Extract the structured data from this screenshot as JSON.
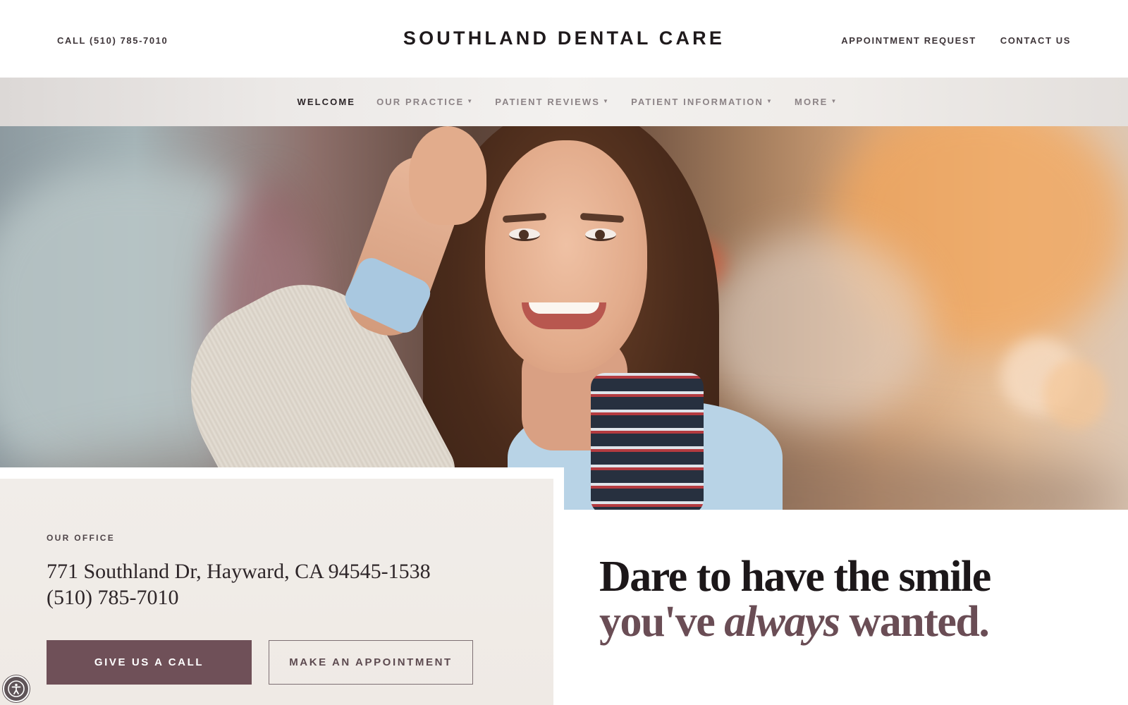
{
  "header": {
    "call_label": "CALL (510) 785-7010",
    "brand": "SOUTHLAND DENTAL CARE",
    "links": [
      "APPOINTMENT REQUEST",
      "CONTACT US"
    ]
  },
  "nav": {
    "items": [
      {
        "label": "WELCOME",
        "has_dropdown": false,
        "active": true
      },
      {
        "label": "OUR PRACTICE",
        "has_dropdown": true,
        "active": false
      },
      {
        "label": "PATIENT REVIEWS",
        "has_dropdown": true,
        "active": false
      },
      {
        "label": "PATIENT INFORMATION",
        "has_dropdown": true,
        "active": false
      },
      {
        "label": "MORE",
        "has_dropdown": true,
        "active": false
      }
    ]
  },
  "hero": {
    "image": "smiling-woman-photo"
  },
  "office": {
    "label": "OUR OFFICE",
    "address": "771 Southland Dr, Hayward, CA 94545-1538",
    "phone": "(510) 785-7010",
    "primary_button": "GIVE US A CALL",
    "secondary_button": "MAKE AN APPOINTMENT"
  },
  "headline": {
    "line1": "Dare to have the smile",
    "line2_before": "you've ",
    "line2_emphasis": "always",
    "line2_after": " wanted."
  },
  "colors": {
    "accent": "#6f5058",
    "headline_dark": "#1c1719",
    "headline_accent": "#6a4d55",
    "card_background": "#f1ede9"
  },
  "icons": {
    "accessibility": "accessibility-icon",
    "dropdown": "caret-down-icon"
  }
}
